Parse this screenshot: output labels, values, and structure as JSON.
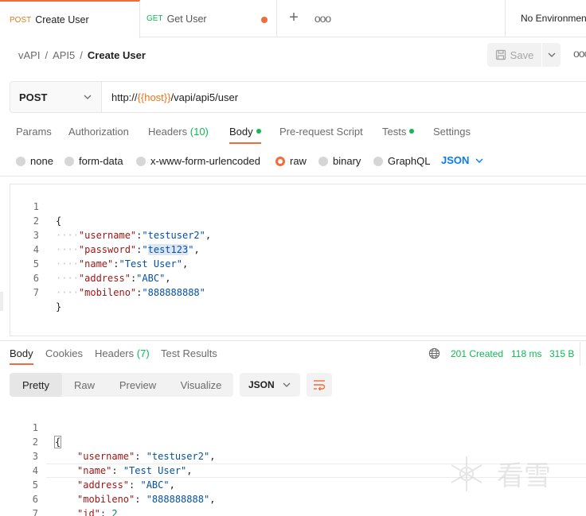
{
  "tabs": [
    {
      "method": "POST",
      "label": "Create User",
      "active": true
    },
    {
      "method": "GET",
      "label": "Get User",
      "active": false,
      "unsaved": true
    }
  ],
  "tab_actions": {
    "add": "+",
    "more": "ooo"
  },
  "environment": {
    "label": "No Environment"
  },
  "breadcrumb": {
    "items": [
      "vAPI",
      "API5"
    ],
    "current": "Create User",
    "separator": "/"
  },
  "header": {
    "save_label": "Save",
    "more": "ooo"
  },
  "request": {
    "method": "POST",
    "url_prefix": "http://",
    "url_variable": "{{host}}",
    "url_suffix": "/vapi/api5/user"
  },
  "request_tabs": [
    {
      "label": "Params"
    },
    {
      "label": "Authorization"
    },
    {
      "label": "Headers",
      "count": "(10)"
    },
    {
      "label": "Body",
      "active": true,
      "dot": true
    },
    {
      "label": "Pre-request Script"
    },
    {
      "label": "Tests",
      "dot": true
    },
    {
      "label": "Settings"
    }
  ],
  "body_types": [
    {
      "label": "none"
    },
    {
      "label": "form-data"
    },
    {
      "label": "x-www-form-urlencoded"
    },
    {
      "label": "raw",
      "selected": true
    },
    {
      "label": "binary"
    },
    {
      "label": "GraphQL"
    }
  ],
  "body_format": "JSON",
  "request_body": {
    "line_numbers": [
      "1",
      "2",
      "3",
      "4",
      "5",
      "6",
      "7"
    ],
    "open": "{",
    "close": "}",
    "indent": "····",
    "fields": [
      {
        "key": "\"username\"",
        "value": "\"testuser2\"",
        "comma": ","
      },
      {
        "key": "\"password\"",
        "value_quote_open": "\"",
        "value_highlight": "test123",
        "value_quote_close": "\"",
        "comma": ","
      },
      {
        "key": "\"name\"",
        "value": "\"Test User\"",
        "comma": ","
      },
      {
        "key": "\"address\"",
        "value": "\"ABC\"",
        "comma": ","
      },
      {
        "key": "\"mobileno\"",
        "value": "\"888888888\"",
        "comma": ""
      }
    ]
  },
  "response_tabs": [
    {
      "label": "Body",
      "active": true
    },
    {
      "label": "Cookies"
    },
    {
      "label": "Headers",
      "count": "(7)"
    },
    {
      "label": "Test Results"
    }
  ],
  "response_meta": {
    "status": "201 Created",
    "time": "118 ms",
    "size": "315 B"
  },
  "view_modes": [
    {
      "label": "Pretty",
      "active": true
    },
    {
      "label": "Raw"
    },
    {
      "label": "Preview"
    },
    {
      "label": "Visualize"
    }
  ],
  "response_format": "JSON",
  "response_body": {
    "line_numbers": [
      "1",
      "2",
      "3",
      "4",
      "5",
      "6",
      "7"
    ],
    "open": "{",
    "close": "}",
    "fields": [
      {
        "key": "\"username\"",
        "value": "\"testuser2\"",
        "comma": ","
      },
      {
        "key": "\"name\"",
        "value": "\"Test User\"",
        "comma": ","
      },
      {
        "key": "\"address\"",
        "value": "\"ABC\"",
        "comma": ","
      },
      {
        "key": "\"mobileno\"",
        "value": "\"888888888\"",
        "comma": ","
      },
      {
        "key": "\"id\"",
        "value": "2",
        "comma": ""
      }
    ]
  },
  "watermark": {
    "text": "看雪"
  },
  "colors": {
    "accent_orange": "#f26b3a",
    "post_method": "#e8781b",
    "get_method": "#0cbb52",
    "success_green": "#0cbb52",
    "link_blue": "#097bed",
    "json_key": "#a31515",
    "json_string": "#0451a5"
  }
}
